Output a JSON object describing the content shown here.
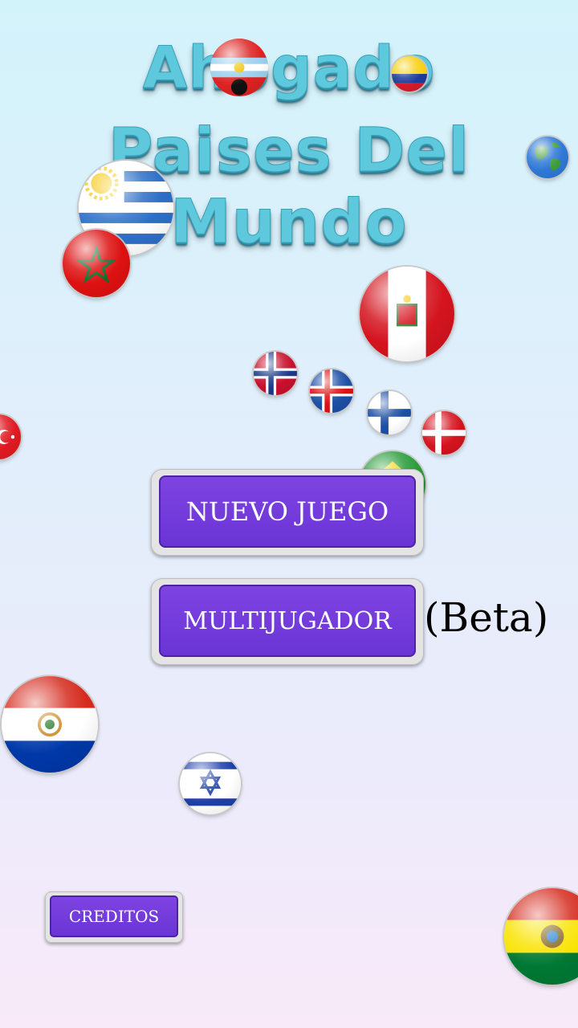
{
  "title": {
    "line1": "Ahogado",
    "line2": "Paises Del Mundo"
  },
  "buttons": {
    "new_game": "NUEVO JUEGO",
    "multiplayer": "MULTIJUGADOR",
    "beta": "(Beta)",
    "credits": "CREDITOS"
  },
  "colors": {
    "button": "#6f3adb",
    "title": "#5ec8dc"
  },
  "flags": [
    "argentina",
    "colombia",
    "earth",
    "uruguay",
    "morocco",
    "peru",
    "norway",
    "iceland",
    "finland",
    "denmark",
    "turkey",
    "brazil",
    "paraguay",
    "israel",
    "bolivia"
  ]
}
